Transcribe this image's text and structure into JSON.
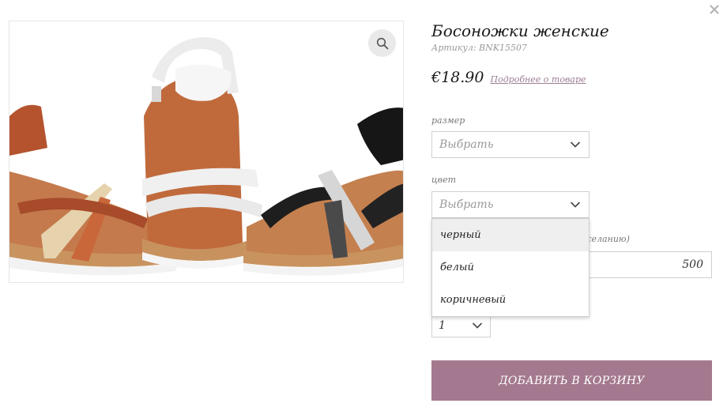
{
  "product": {
    "title": "Босоножки женские",
    "sku_label": "Артикул:",
    "sku_value": "BNK15507",
    "price": "€18.90",
    "more_link": "Подробнее о товаре"
  },
  "size_field": {
    "label": "размер",
    "placeholder": "Выбрать"
  },
  "color_field": {
    "label": "цвет",
    "placeholder": "Выбрать",
    "options": [
      "черный",
      "белый",
      "коричневый"
    ]
  },
  "amount_field": {
    "label_fragment": "желанию)",
    "value": "500"
  },
  "quantity": {
    "value": "1"
  },
  "add_to_cart": "ДОБАВИТЬ В КОРЗИНУ",
  "icons": {
    "close": "close-icon",
    "zoom": "search-icon",
    "chevron": "chevron-down-icon"
  },
  "colors": {
    "accent": "#a4798f",
    "link": "#9a7d93",
    "border": "#cfcfcf"
  }
}
